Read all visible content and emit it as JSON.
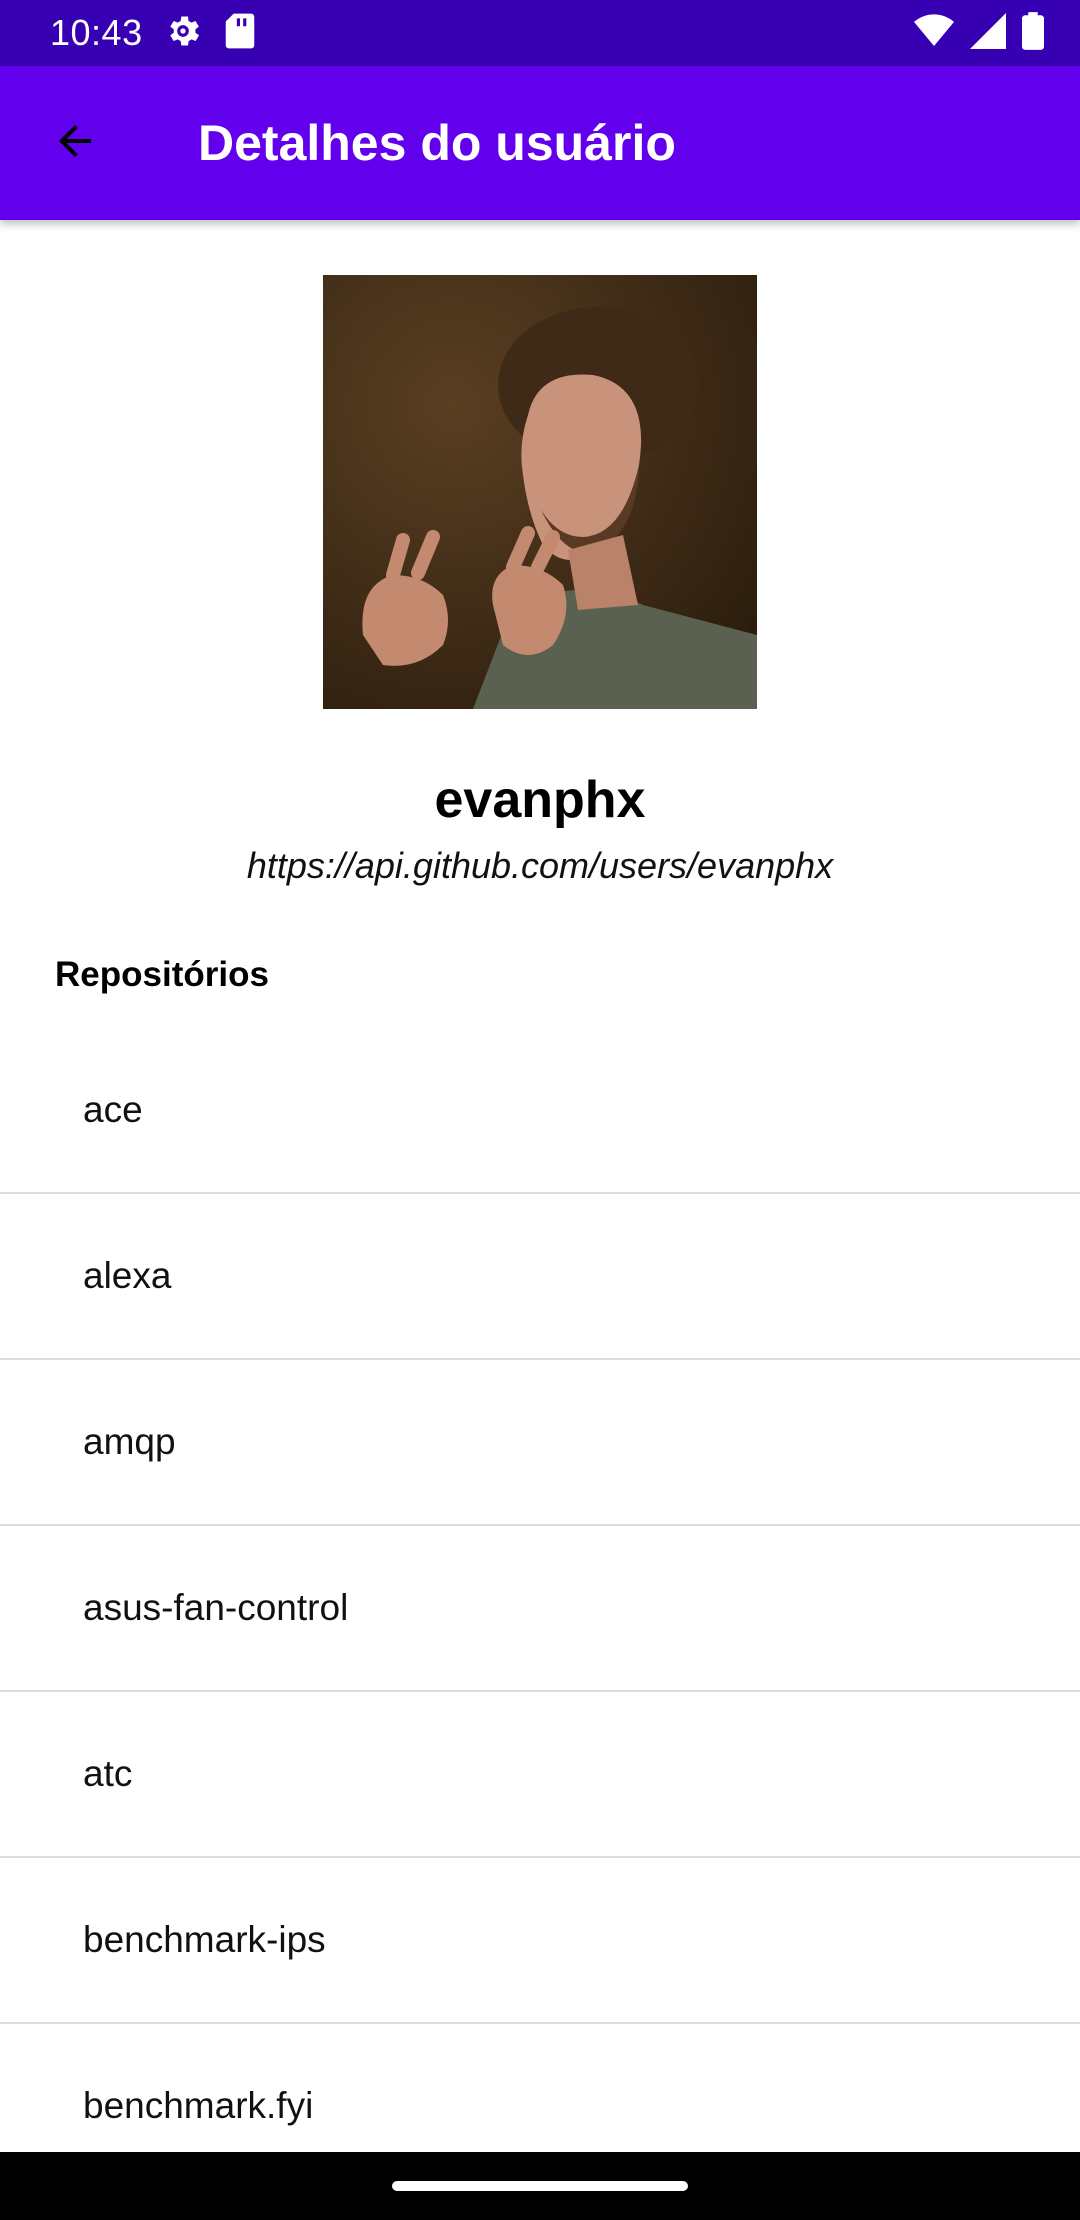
{
  "status_bar": {
    "time": "10:43",
    "icons": [
      "settings-gear-icon",
      "sd-card-icon",
      "wifi-icon",
      "cellular-signal-icon",
      "battery-icon"
    ]
  },
  "app_bar": {
    "title": "Detalhes do usuário",
    "back_icon": "arrow-back-icon"
  },
  "user": {
    "login": "evanphx",
    "url": "https://api.github.com/users/evanphx"
  },
  "repositories": {
    "title": "Repositórios",
    "items": [
      "ace",
      "alexa",
      "amqp",
      "asus-fan-control",
      "atc",
      "benchmark-ips",
      "benchmark.fyi"
    ]
  },
  "colors": {
    "status_bar": "#3700b3",
    "app_bar": "#6200ee"
  }
}
